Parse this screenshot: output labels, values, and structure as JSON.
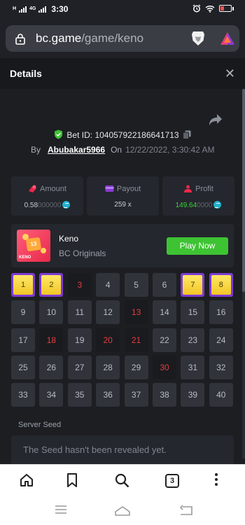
{
  "status_bar": {
    "time": "3:30",
    "net_h": "H",
    "net_4g": "4G"
  },
  "browser": {
    "domain": "bc.game",
    "path": "/game/keno",
    "tab_count": "3"
  },
  "details": {
    "title": "Details",
    "bet_id_label": "Bet ID:",
    "bet_id": "104057922186641713",
    "by_label": "By",
    "user": "Abubakar5966",
    "on_label": "On",
    "date": "12/22/2022, 3:30:42 AM"
  },
  "stats": {
    "amount": {
      "label": "Amount",
      "value_main": "0.58",
      "value_dim": "000000"
    },
    "payout": {
      "label": "Payout",
      "value": "259 x"
    },
    "profit": {
      "label": "Profit",
      "value_main": "149.64",
      "value_dim": "0000"
    }
  },
  "game": {
    "name": "Keno",
    "provider": "BC Originals",
    "play_label": "Play Now",
    "thumb_number": "13",
    "thumb_label": "KENO"
  },
  "keno": {
    "numbers": [
      1,
      2,
      3,
      4,
      5,
      6,
      7,
      8,
      9,
      10,
      11,
      12,
      13,
      14,
      15,
      16,
      17,
      18,
      19,
      20,
      21,
      22,
      23,
      24,
      25,
      26,
      27,
      28,
      29,
      30,
      31,
      32,
      33,
      34,
      35,
      36,
      37,
      38,
      39,
      40
    ],
    "hits": [
      1,
      2,
      7,
      8
    ],
    "picks_missed": [
      3,
      13,
      18,
      20,
      21,
      30
    ]
  },
  "seed": {
    "label": "Server Seed",
    "placeholder": "The Seed hasn't been revealed yet."
  },
  "colors": {
    "accent_green": "#3ec333",
    "hit_purple": "#7e3bd1",
    "hit_yellow": "#f2c627",
    "miss_red": "#e53d3d",
    "profit_green": "#3bd33b"
  },
  "icons": [
    "lock-icon",
    "brave-lion-icon",
    "brave-rewards-icon",
    "close-icon",
    "share-icon",
    "verified-shield-icon",
    "copy-icon",
    "amount-icon",
    "payout-icon",
    "profit-icon",
    "coin-icon",
    "home-icon",
    "bookmark-icon",
    "search-icon",
    "tabs-icon",
    "more-icon",
    "menu-icon",
    "home-nav-icon",
    "back-icon"
  ]
}
